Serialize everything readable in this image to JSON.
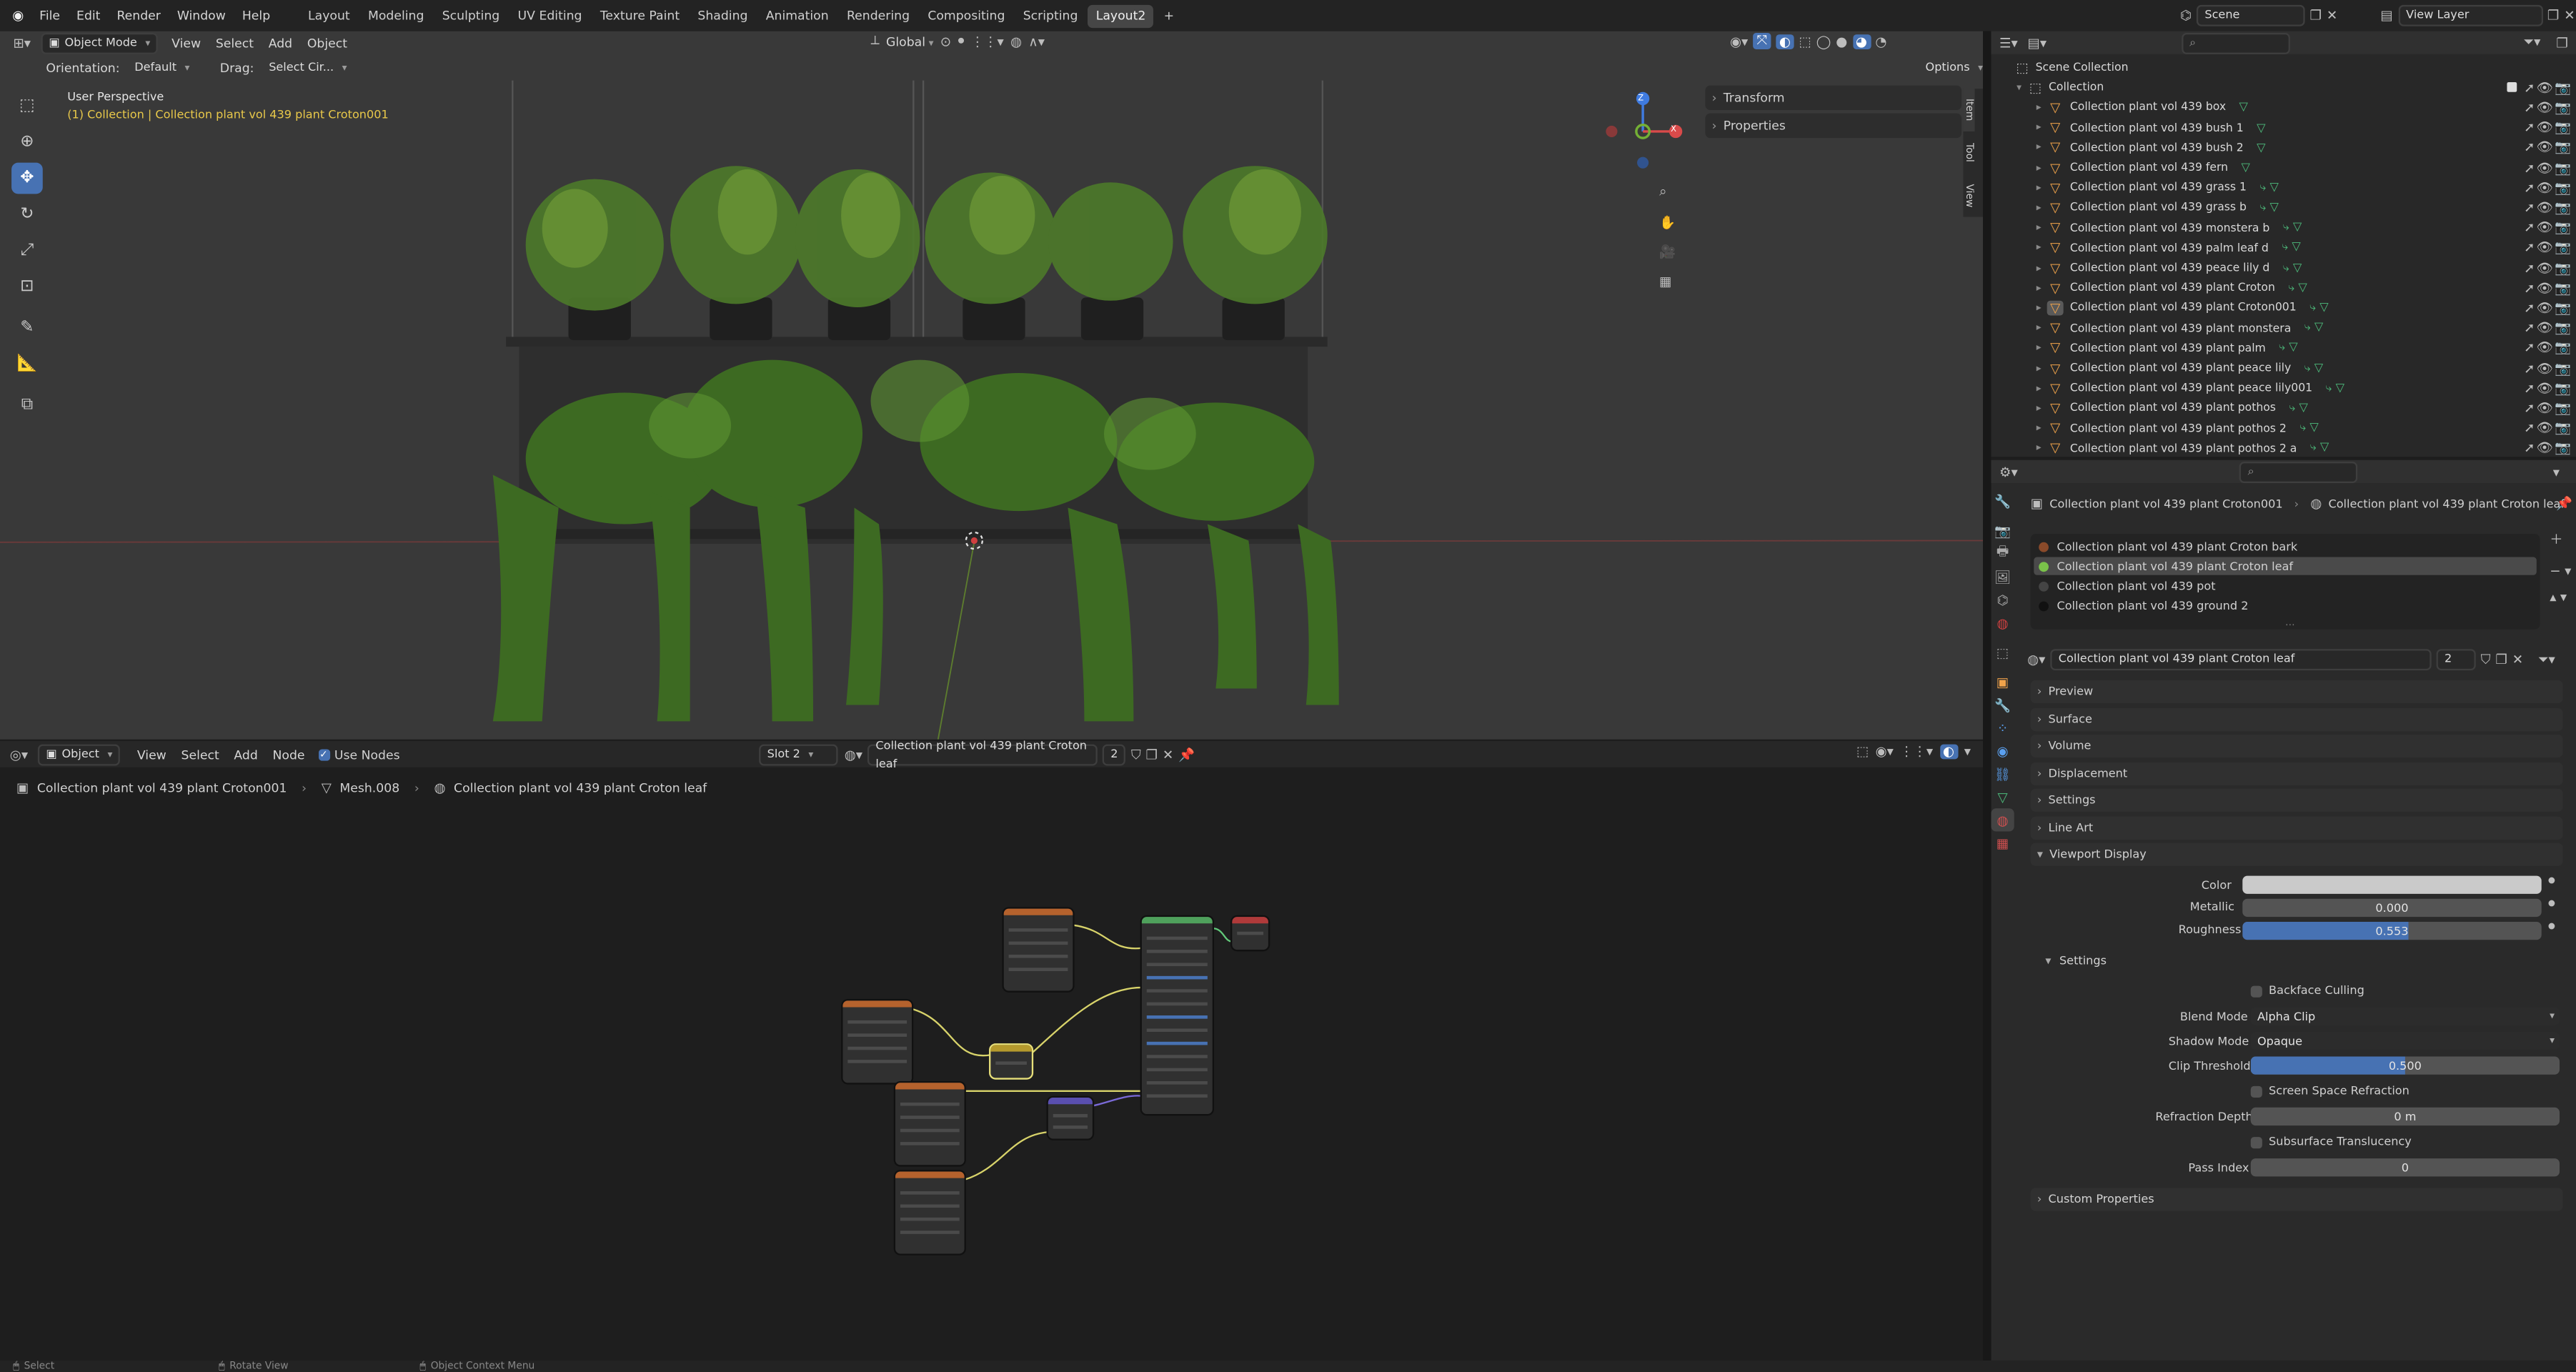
{
  "topbar": {
    "menus": [
      "File",
      "Edit",
      "Render",
      "Window",
      "Help"
    ],
    "workspaces": [
      "Layout",
      "Modeling",
      "Sculpting",
      "UV Editing",
      "Texture Paint",
      "Shading",
      "Animation",
      "Rendering",
      "Compositing",
      "Scripting",
      "Layout2"
    ],
    "active_workspace": "Layout2",
    "add_tab": "+",
    "scene": "Scene",
    "view_layer": "View Layer"
  },
  "viewport": {
    "mode": "Object Mode",
    "menus": [
      "View",
      "Select",
      "Add",
      "Object"
    ],
    "transform_space": "Global",
    "orientation_label": "Orientation:",
    "orientation_value": "Default",
    "drag_label": "Drag:",
    "drag_value": "Select Cir...",
    "options": "Options",
    "perspective": "User Perspective",
    "collection_info": "(1) Collection | Collection plant vol 439 plant Croton001",
    "side_panels": [
      "Transform",
      "Properties"
    ],
    "side_tabs": [
      "Item",
      "Tool",
      "View"
    ],
    "gizmo": {
      "z": "Z",
      "x": "X"
    }
  },
  "node_editor": {
    "mode": "Object",
    "menus": [
      "View",
      "Select",
      "Add",
      "Node"
    ],
    "use_nodes": "Use Nodes",
    "slot": "Slot 2",
    "material": "Collection plant vol 439 plant Croton leaf",
    "users": "2",
    "breadcrumb": [
      "Collection plant vol 439 plant Croton001",
      "Mesh.008",
      "Collection plant vol 439 plant Croton leaf"
    ]
  },
  "outliner": {
    "search_placeholder": "",
    "root": "Scene Collection",
    "collection": "Collection",
    "items": [
      "Collection plant vol 439 box",
      "Collection plant vol 439 bush 1",
      "Collection plant vol 439 bush 2",
      "Collection plant vol 439 fern",
      "Collection plant vol 439 grass 1",
      "Collection plant vol 439 grass b",
      "Collection plant vol 439 monstera b",
      "Collection plant vol 439 palm leaf d",
      "Collection plant vol 439 peace lily d",
      "Collection plant vol 439 plant Croton",
      "Collection plant vol 439 plant Croton001",
      "Collection plant vol 439 plant monstera",
      "Collection plant vol 439 plant palm",
      "Collection plant vol 439 plant peace lily",
      "Collection plant vol 439 plant peace lily001",
      "Collection plant vol 439 plant pothos",
      "Collection plant vol 439 plant pothos 2",
      "Collection plant vol 439 plant pothos 2 a"
    ]
  },
  "properties": {
    "breadcrumb_object": "Collection plant vol 439 plant Croton001",
    "breadcrumb_material": "Collection plant vol 439 plant Croton leaf",
    "material_slots": [
      "Collection plant vol 439 plant Croton bark",
      "Collection plant vol 439 plant Croton leaf",
      "Collection plant vol 439 pot",
      "Collection plant vol 439 ground 2"
    ],
    "active_slot": "Collection plant vol 439 plant Croton leaf",
    "material_name": "Collection plant vol 439 plant Croton leaf",
    "material_users": "2",
    "panels": [
      "Preview",
      "Surface",
      "Volume",
      "Displacement",
      "Settings",
      "Line Art",
      "Viewport Display"
    ],
    "viewport_display": {
      "color_label": "Color",
      "metallic_label": "Metallic",
      "metallic_value": "0.000",
      "roughness_label": "Roughness",
      "roughness_value": "0.553",
      "roughness_fraction": 0.553
    },
    "settings": {
      "title": "Settings",
      "backface_culling": "Backface Culling",
      "blend_mode_label": "Blend Mode",
      "blend_mode_value": "Alpha Clip",
      "shadow_mode_label": "Shadow Mode",
      "shadow_mode_value": "Opaque",
      "clip_threshold_label": "Clip Threshold",
      "clip_threshold_value": "0.500",
      "clip_threshold_fraction": 0.5,
      "screen_space_refraction": "Screen Space Refraction",
      "refraction_depth_label": "Refraction Depth",
      "refraction_depth_value": "0 m",
      "subsurface_translucency": "Subsurface Translucency",
      "pass_index_label": "Pass Index",
      "pass_index_value": "0"
    },
    "custom_properties": "Custom Properties"
  },
  "statusbar": {
    "select": "Select",
    "rotate": "Rotate View",
    "context": "Object Context Menu"
  },
  "colors": {
    "accent": "#4772b3",
    "header": "#303030",
    "background": "#1d1d1d",
    "collection_icon": "#f0a34a",
    "mesh_icon": "#4dbb7b"
  }
}
